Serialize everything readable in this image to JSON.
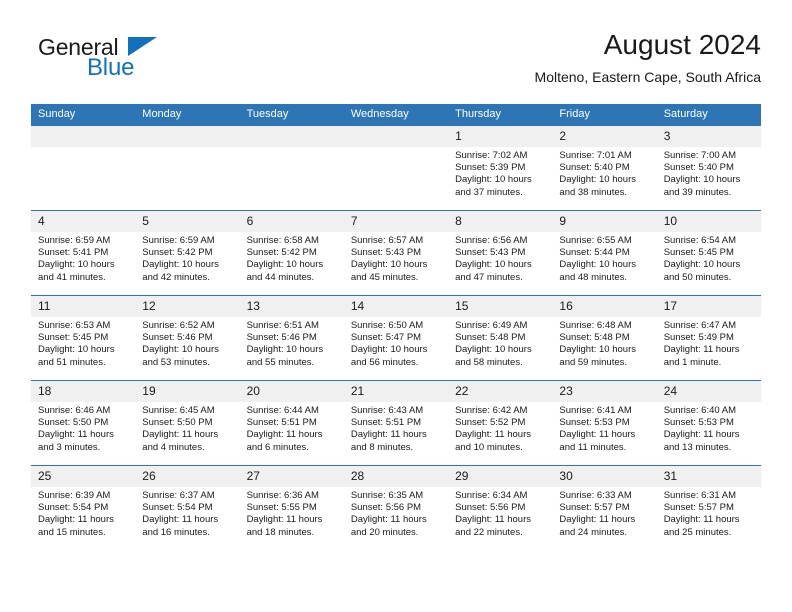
{
  "brand": {
    "word_one": "General",
    "word_two": "Blue",
    "flag_icon": "triangle-flag-icon",
    "accent_color": "#1271bd"
  },
  "header": {
    "title": "August 2024",
    "subtitle": "Molteno, Eastern Cape, South Africa"
  },
  "theme": {
    "header_blue": "#2e75b6",
    "daynum_band": "#f0f0f0",
    "text": "#1a1a1a"
  },
  "calendar": {
    "weekday_headers": [
      "Sunday",
      "Monday",
      "Tuesday",
      "Wednesday",
      "Thursday",
      "Friday",
      "Saturday"
    ],
    "weeks": [
      [
        {
          "day": "",
          "empty": true
        },
        {
          "day": "",
          "empty": true
        },
        {
          "day": "",
          "empty": true
        },
        {
          "day": "",
          "empty": true
        },
        {
          "day": "1",
          "sunrise": "Sunrise: 7:02 AM",
          "sunset": "Sunset: 5:39 PM",
          "daylight_line1": "Daylight: 10 hours",
          "daylight_line2": "and 37 minutes."
        },
        {
          "day": "2",
          "sunrise": "Sunrise: 7:01 AM",
          "sunset": "Sunset: 5:40 PM",
          "daylight_line1": "Daylight: 10 hours",
          "daylight_line2": "and 38 minutes."
        },
        {
          "day": "3",
          "sunrise": "Sunrise: 7:00 AM",
          "sunset": "Sunset: 5:40 PM",
          "daylight_line1": "Daylight: 10 hours",
          "daylight_line2": "and 39 minutes."
        }
      ],
      [
        {
          "day": "4",
          "sunrise": "Sunrise: 6:59 AM",
          "sunset": "Sunset: 5:41 PM",
          "daylight_line1": "Daylight: 10 hours",
          "daylight_line2": "and 41 minutes."
        },
        {
          "day": "5",
          "sunrise": "Sunrise: 6:59 AM",
          "sunset": "Sunset: 5:42 PM",
          "daylight_line1": "Daylight: 10 hours",
          "daylight_line2": "and 42 minutes."
        },
        {
          "day": "6",
          "sunrise": "Sunrise: 6:58 AM",
          "sunset": "Sunset: 5:42 PM",
          "daylight_line1": "Daylight: 10 hours",
          "daylight_line2": "and 44 minutes."
        },
        {
          "day": "7",
          "sunrise": "Sunrise: 6:57 AM",
          "sunset": "Sunset: 5:43 PM",
          "daylight_line1": "Daylight: 10 hours",
          "daylight_line2": "and 45 minutes."
        },
        {
          "day": "8",
          "sunrise": "Sunrise: 6:56 AM",
          "sunset": "Sunset: 5:43 PM",
          "daylight_line1": "Daylight: 10 hours",
          "daylight_line2": "and 47 minutes."
        },
        {
          "day": "9",
          "sunrise": "Sunrise: 6:55 AM",
          "sunset": "Sunset: 5:44 PM",
          "daylight_line1": "Daylight: 10 hours",
          "daylight_line2": "and 48 minutes."
        },
        {
          "day": "10",
          "sunrise": "Sunrise: 6:54 AM",
          "sunset": "Sunset: 5:45 PM",
          "daylight_line1": "Daylight: 10 hours",
          "daylight_line2": "and 50 minutes."
        }
      ],
      [
        {
          "day": "11",
          "sunrise": "Sunrise: 6:53 AM",
          "sunset": "Sunset: 5:45 PM",
          "daylight_line1": "Daylight: 10 hours",
          "daylight_line2": "and 51 minutes."
        },
        {
          "day": "12",
          "sunrise": "Sunrise: 6:52 AM",
          "sunset": "Sunset: 5:46 PM",
          "daylight_line1": "Daylight: 10 hours",
          "daylight_line2": "and 53 minutes."
        },
        {
          "day": "13",
          "sunrise": "Sunrise: 6:51 AM",
          "sunset": "Sunset: 5:46 PM",
          "daylight_line1": "Daylight: 10 hours",
          "daylight_line2": "and 55 minutes."
        },
        {
          "day": "14",
          "sunrise": "Sunrise: 6:50 AM",
          "sunset": "Sunset: 5:47 PM",
          "daylight_line1": "Daylight: 10 hours",
          "daylight_line2": "and 56 minutes."
        },
        {
          "day": "15",
          "sunrise": "Sunrise: 6:49 AM",
          "sunset": "Sunset: 5:48 PM",
          "daylight_line1": "Daylight: 10 hours",
          "daylight_line2": "and 58 minutes."
        },
        {
          "day": "16",
          "sunrise": "Sunrise: 6:48 AM",
          "sunset": "Sunset: 5:48 PM",
          "daylight_line1": "Daylight: 10 hours",
          "daylight_line2": "and 59 minutes."
        },
        {
          "day": "17",
          "sunrise": "Sunrise: 6:47 AM",
          "sunset": "Sunset: 5:49 PM",
          "daylight_line1": "Daylight: 11 hours",
          "daylight_line2": "and 1 minute."
        }
      ],
      [
        {
          "day": "18",
          "sunrise": "Sunrise: 6:46 AM",
          "sunset": "Sunset: 5:50 PM",
          "daylight_line1": "Daylight: 11 hours",
          "daylight_line2": "and 3 minutes."
        },
        {
          "day": "19",
          "sunrise": "Sunrise: 6:45 AM",
          "sunset": "Sunset: 5:50 PM",
          "daylight_line1": "Daylight: 11 hours",
          "daylight_line2": "and 4 minutes."
        },
        {
          "day": "20",
          "sunrise": "Sunrise: 6:44 AM",
          "sunset": "Sunset: 5:51 PM",
          "daylight_line1": "Daylight: 11 hours",
          "daylight_line2": "and 6 minutes."
        },
        {
          "day": "21",
          "sunrise": "Sunrise: 6:43 AM",
          "sunset": "Sunset: 5:51 PM",
          "daylight_line1": "Daylight: 11 hours",
          "daylight_line2": "and 8 minutes."
        },
        {
          "day": "22",
          "sunrise": "Sunrise: 6:42 AM",
          "sunset": "Sunset: 5:52 PM",
          "daylight_line1": "Daylight: 11 hours",
          "daylight_line2": "and 10 minutes."
        },
        {
          "day": "23",
          "sunrise": "Sunrise: 6:41 AM",
          "sunset": "Sunset: 5:53 PM",
          "daylight_line1": "Daylight: 11 hours",
          "daylight_line2": "and 11 minutes."
        },
        {
          "day": "24",
          "sunrise": "Sunrise: 6:40 AM",
          "sunset": "Sunset: 5:53 PM",
          "daylight_line1": "Daylight: 11 hours",
          "daylight_line2": "and 13 minutes."
        }
      ],
      [
        {
          "day": "25",
          "sunrise": "Sunrise: 6:39 AM",
          "sunset": "Sunset: 5:54 PM",
          "daylight_line1": "Daylight: 11 hours",
          "daylight_line2": "and 15 minutes."
        },
        {
          "day": "26",
          "sunrise": "Sunrise: 6:37 AM",
          "sunset": "Sunset: 5:54 PM",
          "daylight_line1": "Daylight: 11 hours",
          "daylight_line2": "and 16 minutes."
        },
        {
          "day": "27",
          "sunrise": "Sunrise: 6:36 AM",
          "sunset": "Sunset: 5:55 PM",
          "daylight_line1": "Daylight: 11 hours",
          "daylight_line2": "and 18 minutes."
        },
        {
          "day": "28",
          "sunrise": "Sunrise: 6:35 AM",
          "sunset": "Sunset: 5:56 PM",
          "daylight_line1": "Daylight: 11 hours",
          "daylight_line2": "and 20 minutes."
        },
        {
          "day": "29",
          "sunrise": "Sunrise: 6:34 AM",
          "sunset": "Sunset: 5:56 PM",
          "daylight_line1": "Daylight: 11 hours",
          "daylight_line2": "and 22 minutes."
        },
        {
          "day": "30",
          "sunrise": "Sunrise: 6:33 AM",
          "sunset": "Sunset: 5:57 PM",
          "daylight_line1": "Daylight: 11 hours",
          "daylight_line2": "and 24 minutes."
        },
        {
          "day": "31",
          "sunrise": "Sunrise: 6:31 AM",
          "sunset": "Sunset: 5:57 PM",
          "daylight_line1": "Daylight: 11 hours",
          "daylight_line2": "and 25 minutes."
        }
      ]
    ]
  }
}
